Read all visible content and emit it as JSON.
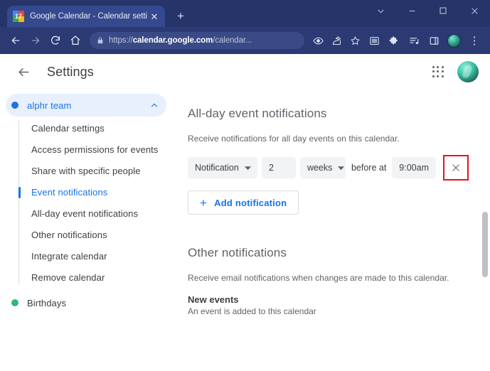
{
  "browser": {
    "tab": {
      "title": "Google Calendar - Calendar setti",
      "favicon_label": "17",
      "close_label": "✕"
    },
    "new_tab_label": "+",
    "window_controls": {
      "chevron_label": "chevron-down",
      "minimize_label": "minimize",
      "maximize_label": "maximize",
      "close_label": "close"
    },
    "nav": {
      "back_label": "back",
      "forward_label": "forward",
      "reload_label": "reload",
      "home_label": "home"
    },
    "omnibox": {
      "lock_label": "site-information",
      "url_prefix": "https://",
      "url_domain": "calendar.google.com",
      "url_path": "/calendar..."
    },
    "toolbar_icons": [
      "eye-icon",
      "share-icon",
      "bookmark-star-icon",
      "screenshot-icon",
      "extensions-puzzle-icon",
      "reading-list-icon",
      "side-panel-icon"
    ],
    "menu_label": "⋮"
  },
  "app_header": {
    "back_label": "back-to-calendar",
    "title": "Settings",
    "apps_label": "google-apps",
    "avatar_label": "account-avatar"
  },
  "sidebar": {
    "group": {
      "name": "alphr team",
      "dot_color": "#1a73e8",
      "expanded": true,
      "items": [
        {
          "label": "Calendar settings",
          "active": false
        },
        {
          "label": "Access permissions for events",
          "active": false
        },
        {
          "label": "Share with specific people",
          "active": false
        },
        {
          "label": "Event notifications",
          "active": true
        },
        {
          "label": "All-day event notifications",
          "active": false
        },
        {
          "label": "Other notifications",
          "active": false
        },
        {
          "label": "Integrate calendar",
          "active": false
        },
        {
          "label": "Remove calendar",
          "active": false
        }
      ]
    },
    "second_group": {
      "name": "Birthdays",
      "dot_color": "#33b679"
    }
  },
  "main": {
    "allday": {
      "title": "All-day event notifications",
      "description": "Receive notifications for all day events on this calendar.",
      "row": {
        "type_value": "Notification",
        "amount_value": "2",
        "unit_value": "weeks",
        "before_label": "before at",
        "time_value": "9:00am",
        "remove_label": "✕",
        "highlighted": true,
        "highlight_color": "#e81123"
      },
      "add_button": {
        "plus": "+",
        "label": "Add notification"
      }
    },
    "other": {
      "title": "Other notifications",
      "description": "Receive email notifications when changes are made to this calendar.",
      "first_setting": {
        "name": "New events",
        "detail": "An event is added to this calendar"
      }
    }
  }
}
